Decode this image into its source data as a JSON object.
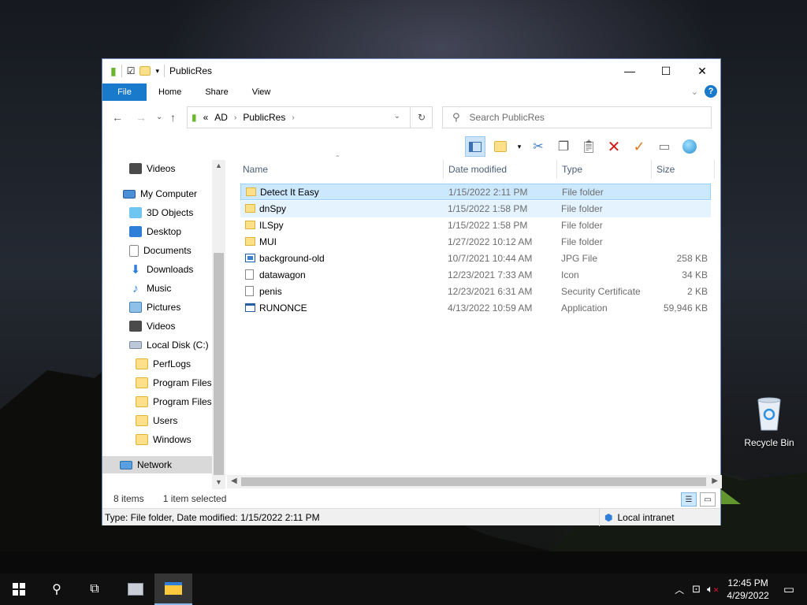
{
  "desktop": {
    "recycle_bin_label": "Recycle Bin"
  },
  "window": {
    "title": "PublicRes",
    "controls": {
      "minimize": "—",
      "maximize": "☐",
      "close": "✕"
    }
  },
  "ribbon": {
    "tabs": [
      "File",
      "Home",
      "Share",
      "View"
    ]
  },
  "navigation": {
    "back": "←",
    "forward": "→",
    "recent": "⌄",
    "up": "↑",
    "address": {
      "prefix": "«",
      "segments": [
        "AD",
        "PublicRes"
      ]
    },
    "refresh": "↻",
    "search_placeholder": "Search PublicRes"
  },
  "nav_pane": {
    "items": [
      {
        "label": "Videos",
        "icon": "video-icon"
      },
      {
        "label": "My Computer",
        "icon": "computer-icon"
      },
      {
        "label": "3D Objects",
        "icon": "3d-objects-icon"
      },
      {
        "label": "Desktop",
        "icon": "desktop-icon"
      },
      {
        "label": "Documents",
        "icon": "documents-icon"
      },
      {
        "label": "Downloads",
        "icon": "downloads-icon"
      },
      {
        "label": "Music",
        "icon": "music-icon"
      },
      {
        "label": "Pictures",
        "icon": "pictures-icon"
      },
      {
        "label": "Videos",
        "icon": "video-icon"
      },
      {
        "label": "Local Disk (C:)",
        "icon": "drive-icon"
      },
      {
        "label": "PerfLogs",
        "icon": "folder-icon"
      },
      {
        "label": "Program Files",
        "icon": "folder-icon"
      },
      {
        "label": "Program Files (",
        "icon": "folder-icon"
      },
      {
        "label": "Users",
        "icon": "folder-icon"
      },
      {
        "label": "Windows",
        "icon": "folder-icon"
      },
      {
        "label": "Network",
        "icon": "network-icon"
      }
    ]
  },
  "columns": [
    "Name",
    "Date modified",
    "Type",
    "Size"
  ],
  "files": [
    {
      "name": "Detect It Easy",
      "date": "1/15/2022 2:11 PM",
      "type": "File folder",
      "size": "",
      "icon": "folder-icon"
    },
    {
      "name": "dnSpy",
      "date": "1/15/2022 1:58 PM",
      "type": "File folder",
      "size": "",
      "icon": "folder-icon"
    },
    {
      "name": "ILSpy",
      "date": "1/15/2022 1:58 PM",
      "type": "File folder",
      "size": "",
      "icon": "folder-icon"
    },
    {
      "name": "MUI",
      "date": "1/27/2022 10:12 AM",
      "type": "File folder",
      "size": "",
      "icon": "folder-icon"
    },
    {
      "name": "background-old",
      "date": "10/7/2021 10:44 AM",
      "type": "JPG File",
      "size": "258 KB",
      "icon": "image-file-icon"
    },
    {
      "name": "datawagon",
      "date": "12/23/2021 7:33 AM",
      "type": "Icon",
      "size": "34 KB",
      "icon": "file-icon"
    },
    {
      "name": "penis",
      "date": "12/23/2021 6:31 AM",
      "type": "Security Certificate",
      "size": "2 KB",
      "icon": "file-icon"
    },
    {
      "name": "RUNONCE",
      "date": "4/13/2022 10:59 AM",
      "type": "Application",
      "size": "59,946 KB",
      "icon": "application-icon"
    }
  ],
  "status": {
    "item_count": "8 items",
    "selected": "1 item selected",
    "details": "Type: File folder, Date modified: 1/15/2022 2:11 PM",
    "zone": "Local intranet"
  },
  "taskbar": {
    "time": "12:45 PM",
    "date": "4/29/2022"
  },
  "colors": {
    "accent": "#1979ca",
    "selection": "#cce8ff",
    "selection_border": "#99d1ff"
  }
}
